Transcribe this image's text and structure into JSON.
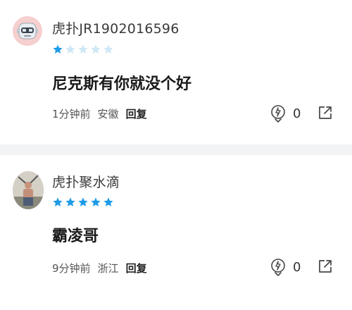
{
  "comments": [
    {
      "username": "虎扑JR1902016596",
      "rating": 1,
      "rating_max": 5,
      "text": "尼克斯有你就没个好",
      "time": "1分钟前",
      "location": "安徽",
      "reply_label": "回复",
      "like_count": "0"
    },
    {
      "username": "虎扑聚水滴",
      "rating": 5,
      "rating_max": 5,
      "text": "霸凌哥",
      "time": "9分钟前",
      "location": "浙江",
      "reply_label": "回复",
      "like_count": "0"
    }
  ],
  "colors": {
    "star_filled": "#1e9be8",
    "star_empty": "#cfe7f6",
    "divider": "#f2f3f5"
  },
  "icons": [
    "avatar-robot-icon",
    "star-icon",
    "like-icon",
    "share-icon"
  ]
}
